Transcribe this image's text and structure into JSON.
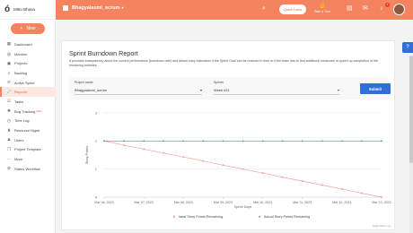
{
  "app": {
    "user_name": "Mitto Bhava",
    "new_button": "New",
    "new_badge": "New"
  },
  "sidebar": {
    "items": [
      {
        "label": "Dashboard",
        "icon": "dashboard-icon",
        "glyph": "▦",
        "active": false
      },
      {
        "label": "Mention",
        "icon": "at-icon",
        "glyph": "@",
        "active": false
      },
      {
        "label": "Projects",
        "icon": "folder-icon",
        "glyph": "▣",
        "active": false
      },
      {
        "label": "Backlog",
        "icon": "backlog-icon",
        "glyph": "≡",
        "active": false
      },
      {
        "label": "Active Sprint",
        "icon": "sprint-icon",
        "glyph": "⟳",
        "active": false
      },
      {
        "label": "Reports",
        "icon": "chart-icon",
        "glyph": "📈",
        "active": true
      },
      {
        "label": "Tasks",
        "icon": "tasks-icon",
        "glyph": "☑",
        "active": false
      },
      {
        "label": "Bug Tracking",
        "icon": "bug-icon",
        "glyph": "✱",
        "active": false,
        "badge": true
      },
      {
        "label": "Time Log",
        "icon": "clock-icon",
        "glyph": "◷",
        "active": false
      },
      {
        "label": "Resource Mgmt",
        "icon": "resource-icon",
        "glyph": "♜",
        "active": false
      },
      {
        "label": "Users",
        "icon": "user-icon",
        "glyph": "♟",
        "active": false
      },
      {
        "label": "Project Template",
        "icon": "template-icon",
        "glyph": "❐",
        "active": false
      },
      {
        "label": "More",
        "icon": "more-icon",
        "glyph": "⋯",
        "active": false
      },
      {
        "label": "Status Workflow",
        "icon": "workflow-icon",
        "glyph": "⚙",
        "active": false
      }
    ]
  },
  "header": {
    "project_name": "Bhagyalaxmi_scrum",
    "quick_links": "Quick Links",
    "take_tour": "Take a Tour",
    "notification_count": "1"
  },
  "main": {
    "title": "Sprint Burndown Report",
    "description": "It provides transparency about the current performance (burndown rate) and allows easy estimation if the Sprint Goal can be reached in time or if the team has to find additional measures to speed up completion of the remaining activities.",
    "project_label": "Project name",
    "project_value": "Bhagyalaxmi_scrum",
    "sprints_label": "Sprints",
    "sprint_value": "Week #11",
    "submit_label": "Submit"
  },
  "colors": {
    "accent": "#f4845f",
    "ideal_line": "#f4a0a0",
    "actual_line": "#4fa6b0",
    "primary_button": "#2e6fd8"
  },
  "chart_data": {
    "type": "line",
    "title": "",
    "xlabel": "Sprint Days",
    "ylabel": "Story Points",
    "categories": [
      "Mar 06, 2023",
      "Mar 07, 2023",
      "Mar 08, 2023",
      "Mar 09, 2023",
      "Mar 10, 2023",
      "Mar 11, 2023",
      "Mar 12, 2023",
      "Mar 13, 2023"
    ],
    "x_tick_labels": [
      "Mar 06, 2023",
      "Mar 07, 2023",
      "Mar 08, 2023",
      "Mar 09, 2023",
      "Mar 10, 2023",
      "Mar 11, 2023",
      "Mar 12, 2023",
      "Mar 13, 2023"
    ],
    "y_tick_labels": [
      "0",
      "1",
      "2",
      "3"
    ],
    "ylim": [
      0,
      3
    ],
    "grid": true,
    "legend_position": "bottom",
    "credit": "Highcharts.com",
    "series": [
      {
        "name": "Ideal Story Points Remaining",
        "color": "#f4a0a0",
        "x": [
          0,
          0.5,
          1,
          1.5,
          2,
          2.5,
          3,
          3.5,
          4,
          4.5,
          5,
          5.5,
          6,
          6.5,
          7
        ],
        "values": [
          2,
          1.85,
          1.71,
          1.57,
          1.43,
          1.29,
          1.14,
          1.0,
          0.86,
          0.71,
          0.57,
          0.43,
          0.29,
          0.14,
          0
        ]
      },
      {
        "name": "Actual Story Points Remaining",
        "color": "#4fa6b0",
        "x": [
          0,
          0.5,
          1,
          1.5,
          2,
          2.5,
          3,
          3.5,
          4,
          4.5,
          5,
          5.5,
          6,
          6.5,
          7
        ],
        "values": [
          2,
          2,
          2,
          2,
          2,
          2,
          2,
          2,
          2,
          2,
          2,
          2,
          2,
          2,
          2
        ]
      }
    ]
  }
}
